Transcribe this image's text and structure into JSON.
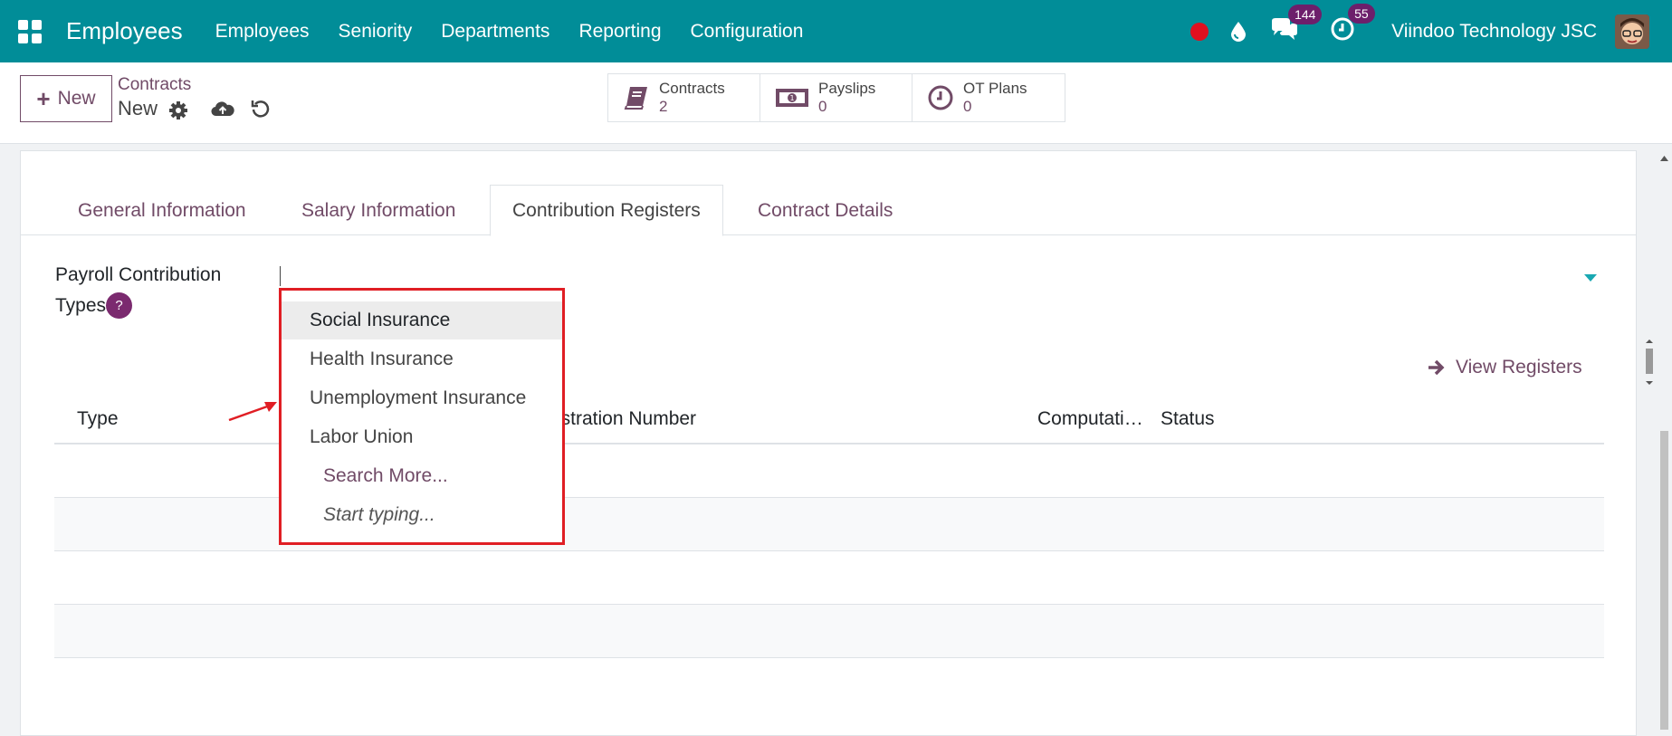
{
  "navbar": {
    "app_title": "Employees",
    "menu": [
      "Employees",
      "Seniority",
      "Departments",
      "Reporting",
      "Configuration"
    ],
    "messages_count": "144",
    "activities_count": "55",
    "company": "Viindoo Technology JSC"
  },
  "control_panel": {
    "new_label": "New",
    "breadcrumb_parent": "Contracts",
    "breadcrumb_current": "New",
    "smart_buttons": [
      {
        "label": "Contracts",
        "value": "2",
        "icon": "book-icon"
      },
      {
        "label": "Payslips",
        "value": "0",
        "icon": "money-icon"
      },
      {
        "label": "OT Plans",
        "value": "0",
        "icon": "clock-icon"
      }
    ]
  },
  "tabs": [
    "General Information",
    "Salary Information",
    "Contribution Registers",
    "Contract Details"
  ],
  "active_tab": "Contribution Registers",
  "field": {
    "label_line1": "Payroll Contribution",
    "label_line2": "Types",
    "help": "?"
  },
  "view_registers": "View Registers",
  "table": {
    "headers": [
      "Type",
      "istration Number",
      "Computati…",
      "Status"
    ]
  },
  "dropdown": {
    "options": [
      "Social Insurance",
      "Health Insurance",
      "Unemployment Insurance",
      "Labor Union"
    ],
    "search_more": "Search More...",
    "hint": "Start typing..."
  },
  "colors": {
    "navbar": "#018d98",
    "accent": "#714b67",
    "highlight_box": "#e01e24"
  }
}
